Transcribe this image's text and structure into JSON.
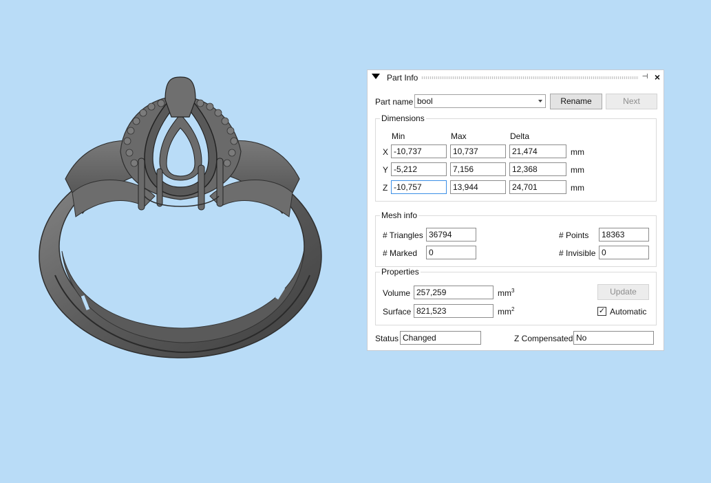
{
  "panel": {
    "title": "Part Info",
    "part_name_label": "Part name",
    "part_name_value": "bool",
    "rename_label": "Rename",
    "next_label": "Next",
    "dimensions": {
      "title": "Dimensions",
      "col_min": "Min",
      "col_max": "Max",
      "col_delta": "Delta",
      "unit": "mm",
      "rows": [
        {
          "axis": "X",
          "min": "-10,737",
          "max": "10,737",
          "delta": "21,474"
        },
        {
          "axis": "Y",
          "min": "-5,212",
          "max": "7,156",
          "delta": "12,368"
        },
        {
          "axis": "Z",
          "min": "-10,757",
          "max": "13,944",
          "delta": "24,701"
        }
      ]
    },
    "mesh_info": {
      "title": "Mesh info",
      "triangles_label": "# Triangles",
      "triangles_value": "36794",
      "points_label": "# Points",
      "points_value": "18363",
      "marked_label": "# Marked",
      "marked_value": "0",
      "invisible_label": "# Invisible",
      "invisible_value": "0"
    },
    "properties": {
      "title": "Properties",
      "volume_label": "Volume",
      "volume_value": "257,259",
      "volume_unit": "mm",
      "volume_unit_sup": "3",
      "surface_label": "Surface",
      "surface_value": "821,523",
      "surface_unit": "mm",
      "surface_unit_sup": "2",
      "update_label": "Update",
      "automatic_label": "Automatic",
      "automatic_checked": true
    },
    "status_label": "Status",
    "status_value": "Changed",
    "z_comp_label": "Z Compensated",
    "z_comp_value": "No"
  }
}
